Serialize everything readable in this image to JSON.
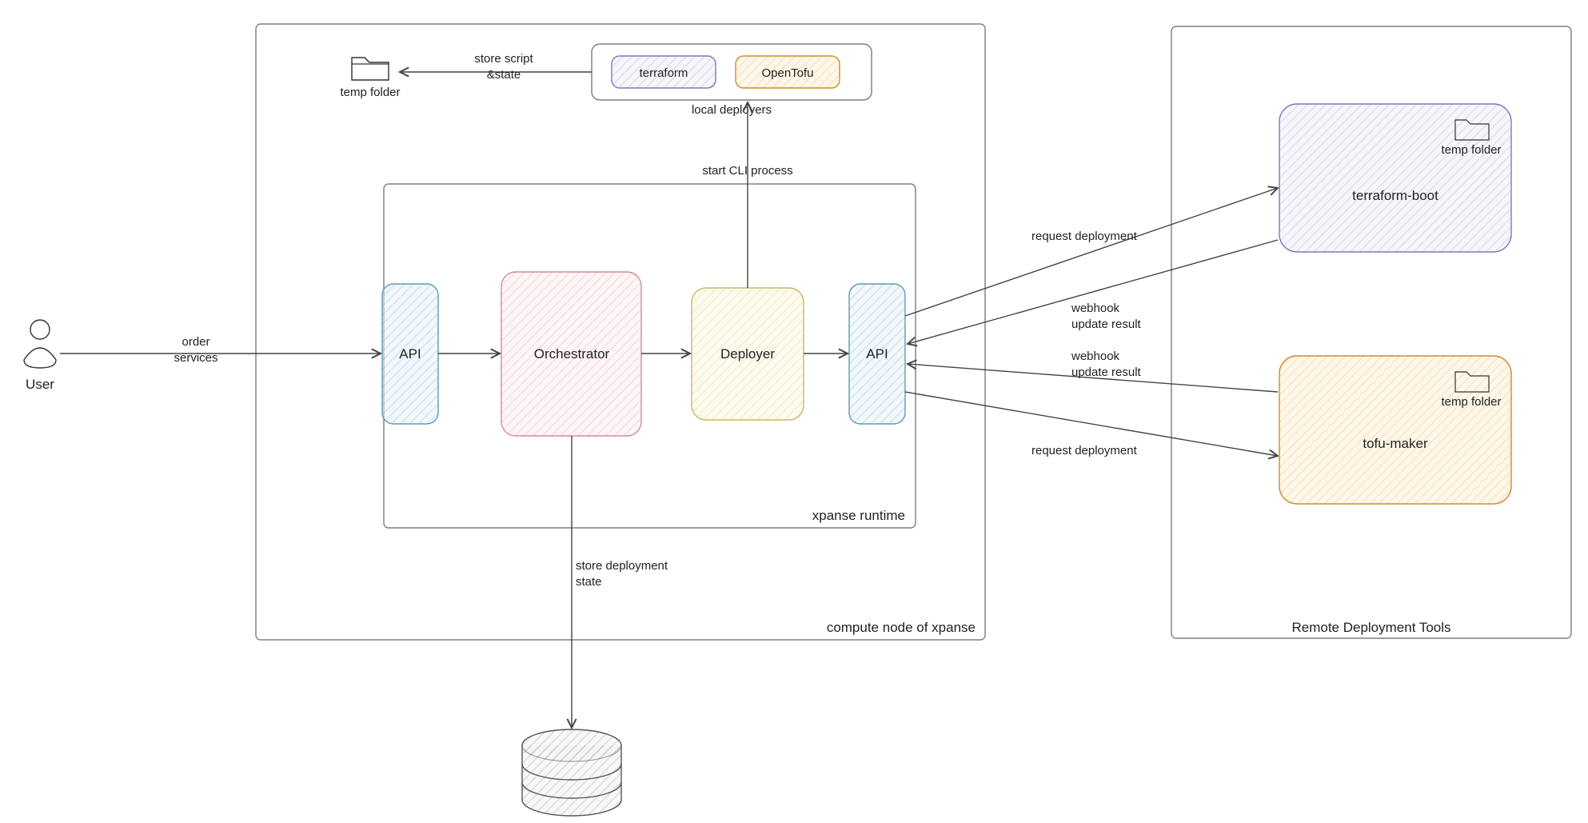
{
  "actors": {
    "user": {
      "label": "User"
    }
  },
  "groups": {
    "compute_node": {
      "label": "compute node of xpanse"
    },
    "local_deployers": {
      "label": "local deployers"
    },
    "xpanse_runtime": {
      "label": "xpanse runtime"
    },
    "remote_tools": {
      "label": "Remote Deployment Tools"
    }
  },
  "nodes": {
    "temp_folder_local": {
      "label": "temp folder",
      "icon": "folder-icon"
    },
    "terraform": {
      "label": "terraform",
      "color_fill": "#d9d6f2",
      "color_stroke": "#7c78c2"
    },
    "opentofu": {
      "label": "OpenTofu",
      "color_fill": "#fbd9a0",
      "color_stroke": "#d08a2e"
    },
    "api_left": {
      "label": "API",
      "color_fill": "#cfe8f4",
      "color_stroke": "#5c9bb8"
    },
    "orchestrator": {
      "label": "Orchestrator",
      "color_fill": "#f7d9dc",
      "color_stroke": "#cf8d94"
    },
    "deployer": {
      "label": "Deployer",
      "color_fill": "#f7efc8",
      "color_stroke": "#c8b96a"
    },
    "api_right": {
      "label": "API",
      "color_fill": "#cfe8f4",
      "color_stroke": "#5c9bb8"
    },
    "terraform_boot": {
      "label": "terraform-boot",
      "temp_label": "temp folder",
      "color_fill": "#d9d6f2",
      "color_stroke": "#7c78c2"
    },
    "tofu_maker": {
      "label": "tofu-maker",
      "temp_label": "temp folder",
      "color_fill": "#fbd9a0",
      "color_stroke": "#d08a2e"
    },
    "database": {
      "icon": "database-icon"
    }
  },
  "edges": {
    "order_services": {
      "line1": "order",
      "line2": "services"
    },
    "store_script": {
      "line1": "store script",
      "line2": "&state"
    },
    "start_cli": {
      "label": "start CLI process"
    },
    "store_state": {
      "line1": "store deployment",
      "line2": "state"
    },
    "req_deploy_1": {
      "label": "request deployment"
    },
    "webhook_1": {
      "line1": "webhook",
      "line2": "update result"
    },
    "webhook_2": {
      "line1": "webhook",
      "line2": "update result"
    },
    "req_deploy_2": {
      "label": "request deployment"
    }
  }
}
